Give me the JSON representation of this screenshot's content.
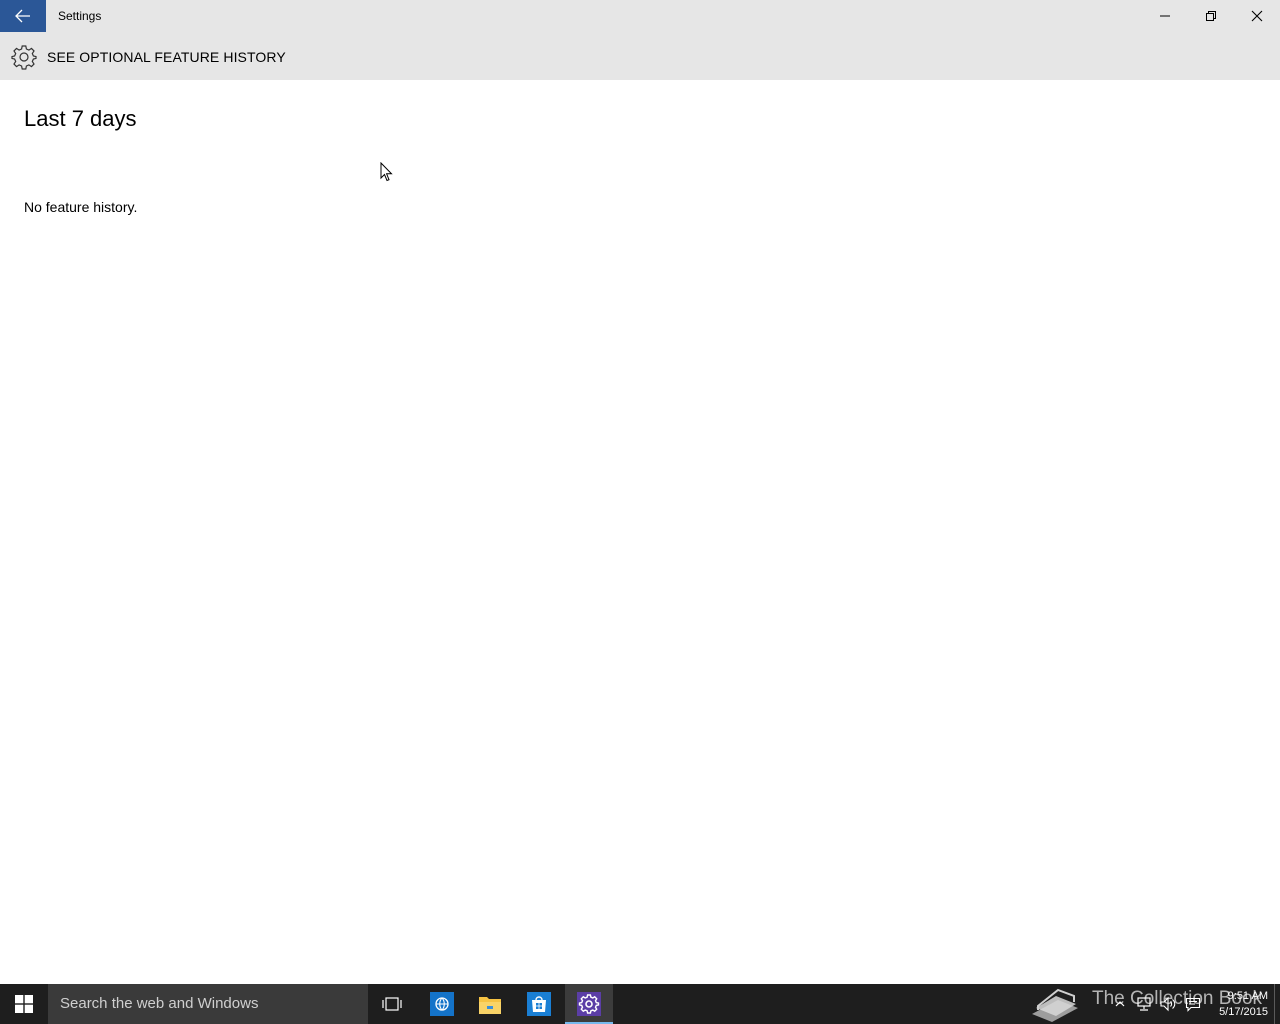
{
  "window": {
    "app_title": "Settings",
    "accent_color": "#2b5797",
    "back_icon": "arrow-left-icon",
    "controls": [
      "minimize-icon",
      "restore-icon",
      "close-icon"
    ]
  },
  "page": {
    "header_icon": "gear-icon",
    "title": "SEE OPTIONAL FEATURE HISTORY"
  },
  "content": {
    "section_heading": "Last 7 days",
    "empty_message": "No feature history."
  },
  "taskbar": {
    "search_placeholder": "Search the web and Windows",
    "pinned_icons": [
      "task-view-icon",
      "internet-explorer-icon",
      "file-explorer-icon",
      "store-icon",
      "settings-icon"
    ],
    "active_app": "settings",
    "watermark_text": "The Collection Book",
    "tray_icons": [
      "chevron-up-icon",
      "network-icon",
      "volume-icon",
      "action-center-icon"
    ],
    "clock": {
      "time": "9:51 AM",
      "date": "5/17/2015"
    }
  }
}
